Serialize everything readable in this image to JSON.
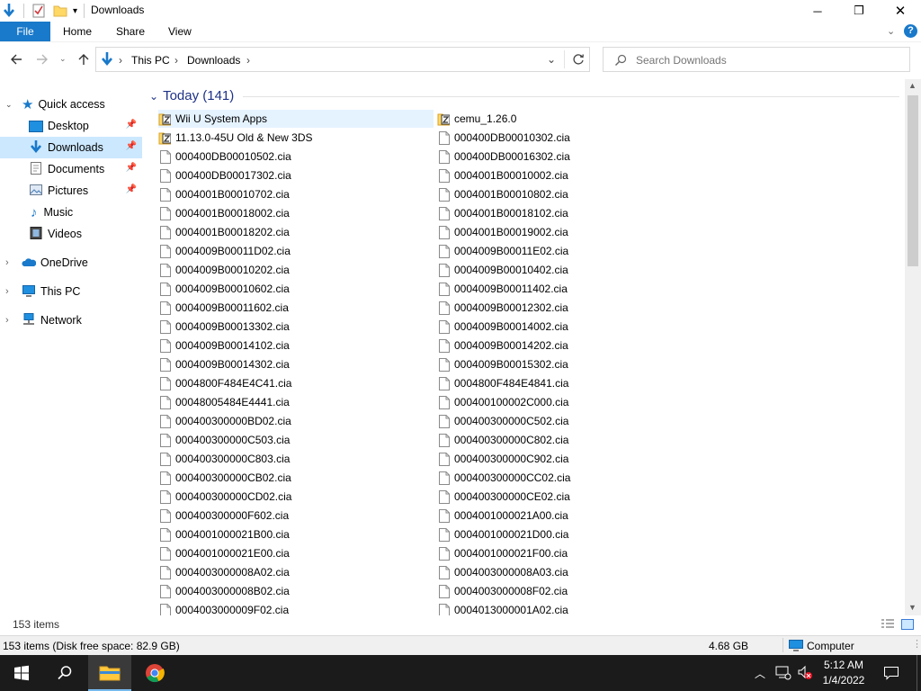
{
  "window": {
    "title": "Downloads",
    "minimize": "─",
    "maximize": "❐",
    "close": "✕"
  },
  "ribbon": {
    "file": "File",
    "home": "Home",
    "share": "Share",
    "view": "View",
    "help": "?"
  },
  "address": {
    "segments": [
      "This PC",
      "Downloads"
    ],
    "separator": "›"
  },
  "search": {
    "placeholder": "Search Downloads"
  },
  "sidebar": {
    "quick_access": "Quick access",
    "items": [
      {
        "label": "Desktop",
        "icon": "desktop-icon",
        "pinned": true
      },
      {
        "label": "Downloads",
        "icon": "downloads-icon",
        "pinned": true,
        "selected": true
      },
      {
        "label": "Documents",
        "icon": "documents-icon",
        "pinned": true
      },
      {
        "label": "Pictures",
        "icon": "pictures-icon",
        "pinned": true
      },
      {
        "label": "Music",
        "icon": "music-icon",
        "pinned": false
      },
      {
        "label": "Videos",
        "icon": "videos-icon",
        "pinned": false
      }
    ],
    "onedrive": "OneDrive",
    "this_pc": "This PC",
    "network": "Network"
  },
  "group": {
    "label": "Today (141)"
  },
  "files_left": [
    {
      "name": "Wii U System Apps",
      "type": "zip-folder"
    },
    {
      "name": "11.13.0-45U Old & New 3DS",
      "type": "zip-folder"
    },
    {
      "name": "000400DB00010502.cia",
      "type": "file"
    },
    {
      "name": "000400DB00017302.cia",
      "type": "file"
    },
    {
      "name": "0004001B00010702.cia",
      "type": "file"
    },
    {
      "name": "0004001B00018002.cia",
      "type": "file"
    },
    {
      "name": "0004001B00018202.cia",
      "type": "file"
    },
    {
      "name": "0004009B00011D02.cia",
      "type": "file"
    },
    {
      "name": "0004009B00010202.cia",
      "type": "file"
    },
    {
      "name": "0004009B00010602.cia",
      "type": "file"
    },
    {
      "name": "0004009B00011602.cia",
      "type": "file"
    },
    {
      "name": "0004009B00013302.cia",
      "type": "file"
    },
    {
      "name": "0004009B00014102.cia",
      "type": "file"
    },
    {
      "name": "0004009B00014302.cia",
      "type": "file"
    },
    {
      "name": "0004800F484E4C41.cia",
      "type": "file"
    },
    {
      "name": "00048005484E4441.cia",
      "type": "file"
    },
    {
      "name": "000400300000BD02.cia",
      "type": "file"
    },
    {
      "name": "000400300000C503.cia",
      "type": "file"
    },
    {
      "name": "000400300000C803.cia",
      "type": "file"
    },
    {
      "name": "000400300000CB02.cia",
      "type": "file"
    },
    {
      "name": "000400300000CD02.cia",
      "type": "file"
    },
    {
      "name": "000400300000F602.cia",
      "type": "file"
    },
    {
      "name": "0004001000021B00.cia",
      "type": "file"
    },
    {
      "name": "0004001000021E00.cia",
      "type": "file"
    },
    {
      "name": "0004003000008A02.cia",
      "type": "file"
    },
    {
      "name": "0004003000008B02.cia",
      "type": "file"
    },
    {
      "name": "0004003000009F02.cia",
      "type": "file"
    }
  ],
  "files_right": [
    {
      "name": "cemu_1.26.0",
      "type": "zip-folder"
    },
    {
      "name": "000400DB00010302.cia",
      "type": "file"
    },
    {
      "name": "000400DB00016302.cia",
      "type": "file"
    },
    {
      "name": "0004001B00010002.cia",
      "type": "file"
    },
    {
      "name": "0004001B00010802.cia",
      "type": "file"
    },
    {
      "name": "0004001B00018102.cia",
      "type": "file"
    },
    {
      "name": "0004001B00019002.cia",
      "type": "file"
    },
    {
      "name": "0004009B00011E02.cia",
      "type": "file"
    },
    {
      "name": "0004009B00010402.cia",
      "type": "file"
    },
    {
      "name": "0004009B00011402.cia",
      "type": "file"
    },
    {
      "name": "0004009B00012302.cia",
      "type": "file"
    },
    {
      "name": "0004009B00014002.cia",
      "type": "file"
    },
    {
      "name": "0004009B00014202.cia",
      "type": "file"
    },
    {
      "name": "0004009B00015302.cia",
      "type": "file"
    },
    {
      "name": "0004800F484E4841.cia",
      "type": "file"
    },
    {
      "name": "000400100002C000.cia",
      "type": "file"
    },
    {
      "name": "000400300000C502.cia",
      "type": "file"
    },
    {
      "name": "000400300000C802.cia",
      "type": "file"
    },
    {
      "name": "000400300000C902.cia",
      "type": "file"
    },
    {
      "name": "000400300000CC02.cia",
      "type": "file"
    },
    {
      "name": "000400300000CE02.cia",
      "type": "file"
    },
    {
      "name": "0004001000021A00.cia",
      "type": "file"
    },
    {
      "name": "0004001000021D00.cia",
      "type": "file"
    },
    {
      "name": "0004001000021F00.cia",
      "type": "file"
    },
    {
      "name": "0004003000008A03.cia",
      "type": "file"
    },
    {
      "name": "0004003000008F02.cia",
      "type": "file"
    },
    {
      "name": "0004013000001A02.cia",
      "type": "file"
    }
  ],
  "count_row": {
    "items": "153 items"
  },
  "status": {
    "summary": "153 items (Disk free space: 82.9 GB)",
    "size": "4.68 GB",
    "location": "Computer"
  },
  "taskbar": {
    "time": "5:12 AM",
    "date": "1/4/2022"
  },
  "colors": {
    "accent": "#1979ca",
    "selection": "#cce8ff",
    "group_header": "#1e3287",
    "taskbar": "#1b1b1b"
  }
}
